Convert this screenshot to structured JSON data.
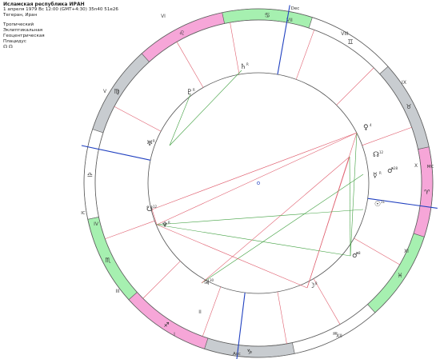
{
  "header": {
    "title": "Исламская республика ИРАН",
    "line2": "1 апреля 1979  Вс  12:00 (GMT+4:30) 35n40  51e26",
    "line3": "Тегеран, Иран",
    "settings": [
      "Тропический",
      "Эклиптикальная",
      "Геоцентрическая",
      "Плацидус"
    ],
    "node_line": "☊ ☊"
  },
  "colors": {
    "fire": "#f6a6d8",
    "earth": "#c8ccd0",
    "air": "#ffffff",
    "water": "#a6f0b0",
    "axis": "#2040c0",
    "house_line": "#e06070",
    "aspect_red": "#e06070",
    "aspect_green": "#40a040",
    "ring": "#606060"
  },
  "angles": [
    {
      "label": "Dec",
      "id": "mc-dec"
    },
    {
      "label": "MC",
      "id": "mc"
    },
    {
      "label": "IC",
      "id": "ic"
    },
    {
      "label": "Asc",
      "id": "asc"
    }
  ],
  "houses": [
    "I",
    "II",
    "III",
    "IV",
    "V",
    "VI",
    "VII",
    "VIII",
    "IX",
    "X",
    "XI",
    "XII"
  ],
  "signs": [
    {
      "name": "aries",
      "glyph": "♈"
    },
    {
      "name": "taurus",
      "glyph": "♉"
    },
    {
      "name": "gemini",
      "glyph": "♊"
    },
    {
      "name": "cancer",
      "glyph": "♋"
    },
    {
      "name": "leo",
      "glyph": "♌"
    },
    {
      "name": "virgo",
      "glyph": "♍"
    },
    {
      "name": "libra",
      "glyph": "♎"
    },
    {
      "name": "scorpio",
      "glyph": "♏"
    },
    {
      "name": "sagittarius",
      "glyph": "♐"
    },
    {
      "name": "capricorn",
      "glyph": "♑"
    },
    {
      "name": "aquarius",
      "glyph": "♒"
    },
    {
      "name": "pisces",
      "glyph": "♓"
    }
  ],
  "planets": [
    {
      "name": "venus",
      "glyph": "♀",
      "deg": "4"
    },
    {
      "name": "mars",
      "glyph": "♂",
      "deg": "28"
    },
    {
      "name": "mercury",
      "glyph": "☿",
      "deg": "R"
    },
    {
      "name": "node",
      "glyph": "☊",
      "deg": "12"
    },
    {
      "name": "sun",
      "glyph": "☉",
      "deg": "11"
    },
    {
      "name": "moon",
      "glyph": "☽",
      "deg": "8"
    },
    {
      "name": "sun2",
      "glyph": "♂",
      "deg": "8"
    },
    {
      "name": "jupiter",
      "glyph": "♃",
      "deg": "30"
    },
    {
      "name": "neptune",
      "glyph": "♆",
      "deg": "R"
    },
    {
      "name": "uranus",
      "glyph": "♅",
      "deg": "R"
    },
    {
      "name": "pluto",
      "glyph": "♇",
      "deg": "R"
    },
    {
      "name": "saturn",
      "glyph": "♄",
      "deg": "R"
    },
    {
      "name": "node2",
      "glyph": "☋",
      "deg": "12"
    }
  ]
}
